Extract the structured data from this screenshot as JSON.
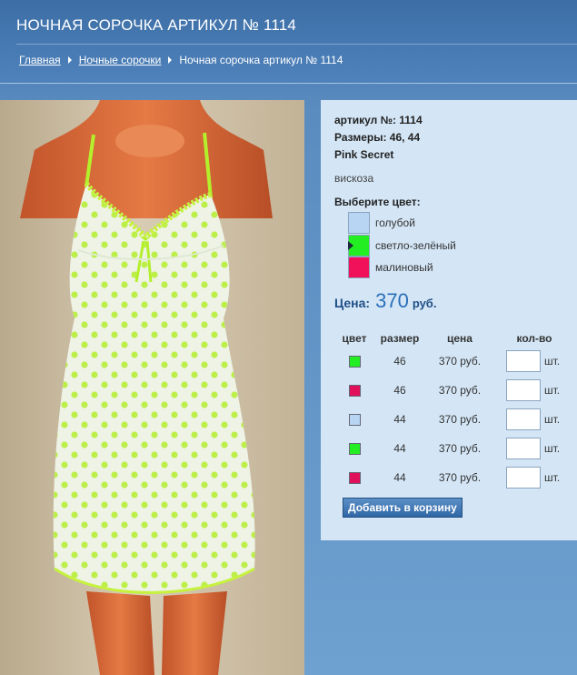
{
  "header": {
    "title": "НОЧНАЯ СОРОЧКА АРТИКУЛ № 1114",
    "breadcrumb": {
      "home": "Главная",
      "category": "Ночные сорочки",
      "current": "Ночная сорочка артикул № 1114"
    }
  },
  "product": {
    "article": "артикул №: 1114",
    "sizes": "Размеры: 46, 44",
    "brand": "Pink Secret",
    "material": "вискоза",
    "choose_color_label": "Выберите цвет:",
    "colors": [
      {
        "name": "голубой",
        "hex": "#b8d6f3",
        "selected": false
      },
      {
        "name": "светло-зелёный",
        "hex": "#22ee22",
        "selected": true
      },
      {
        "name": "малиновый",
        "hex": "#f0115a",
        "selected": false
      }
    ],
    "price_label": "Цена:",
    "price_value": "370",
    "price_currency": "руб."
  },
  "variants": {
    "headers": {
      "color": "цвет",
      "size": "размер",
      "price": "цена",
      "qty": "кол-во"
    },
    "unit": "шт.",
    "rows": [
      {
        "color_hex": "#22ee22",
        "size": "46",
        "price": "370 руб.",
        "qty": ""
      },
      {
        "color_hex": "#e0105a",
        "size": "46",
        "price": "370 руб.",
        "qty": ""
      },
      {
        "color_hex": "#b8d6f3",
        "size": "44",
        "price": "370 руб.",
        "qty": ""
      },
      {
        "color_hex": "#22ee22",
        "size": "44",
        "price": "370 руб.",
        "qty": ""
      },
      {
        "color_hex": "#e0105a",
        "size": "44",
        "price": "370 руб.",
        "qty": ""
      }
    ],
    "add_to_cart_label": "Добавить в корзину"
  }
}
